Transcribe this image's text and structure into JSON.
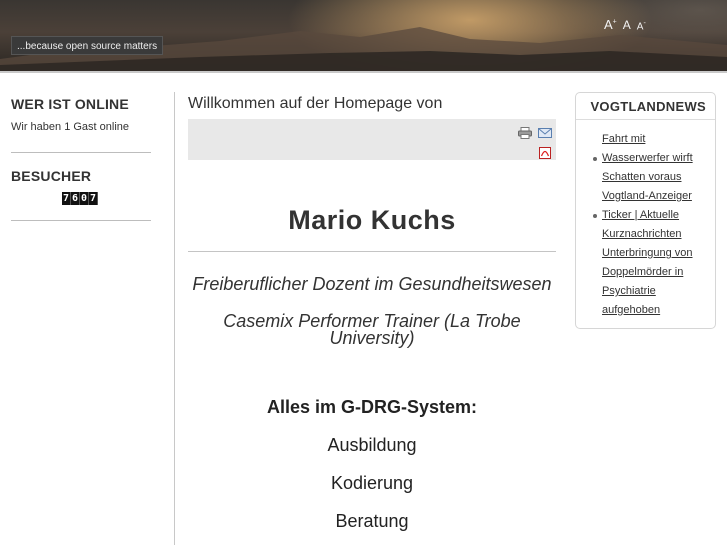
{
  "header": {
    "tagline": "...because open source matters",
    "font_controls": {
      "larger": "A",
      "larger_mark": "+",
      "reset": "A",
      "smaller": "A",
      "smaller_mark": "-"
    }
  },
  "left": {
    "online": {
      "title": "WER IST ONLINE",
      "text": "Wir haben 1 Gast online"
    },
    "visitors": {
      "title": "BESUCHER",
      "digits": [
        "7",
        "6",
        "0",
        "7"
      ]
    }
  },
  "main": {
    "article_title": "Willkommen auf der Homepage von",
    "icons": [
      "print-icon",
      "email-icon",
      "pdf-icon"
    ],
    "name": "Mario Kuchs",
    "lines": [
      "Freiberuflicher Dozent im Gesundheitswesen",
      "Casemix Performer Trainer (La Trobe University)"
    ],
    "heading": "Alles im G-DRG-System:",
    "items": [
      "Ausbildung",
      "Kodierung",
      "Beratung"
    ]
  },
  "right": {
    "title": "VOGTLANDNEWS",
    "news": [
      {
        "label": "Fahrt mit",
        "bullet": false
      },
      {
        "label": "Wasserwerfer wirft Schatten voraus Vogtland-Anzeiger",
        "bullet": true
      },
      {
        "label": "Ticker | Aktuelle Kurznachrichten Unterbringung von Doppelmörder in Psychiatrie aufgehoben",
        "bullet": true
      }
    ]
  }
}
